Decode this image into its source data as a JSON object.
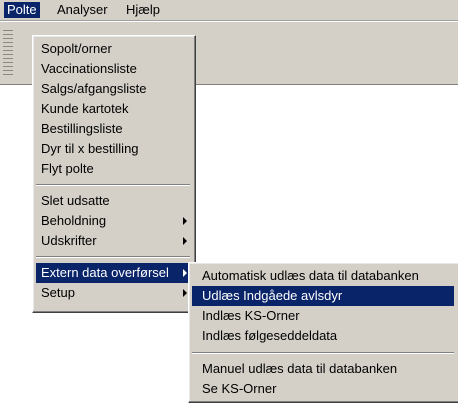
{
  "menubar": {
    "items": [
      {
        "label": "Polte",
        "active": true
      },
      {
        "label": "Analyser",
        "active": false
      },
      {
        "label": "Hjælp",
        "active": false
      }
    ]
  },
  "polte_menu": {
    "items": [
      {
        "label": "Sopolt/orner"
      },
      {
        "label": "Vaccinationsliste"
      },
      {
        "label": "Salgs/afgangsliste"
      },
      {
        "label": "Kunde kartotek"
      },
      {
        "label": "Bestillingsliste"
      },
      {
        "label": "Dyr til x bestilling"
      },
      {
        "label": "Flyt polte"
      },
      {
        "label": "Slet udsatte"
      },
      {
        "label": "Beholdning",
        "submenu": true
      },
      {
        "label": "Udskrifter",
        "submenu": true
      },
      {
        "label": "Extern data overførsel",
        "submenu": true,
        "selected": true
      },
      {
        "label": "Setup",
        "submenu": true
      }
    ]
  },
  "extern_submenu": {
    "items": [
      {
        "label": "Automatisk udlæs data til databanken"
      },
      {
        "label": "Udlæs Indgåede avlsdyr",
        "selected": true
      },
      {
        "label": "Indlæs KS-Orner"
      },
      {
        "label": "Indlæs følgeseddeldata"
      },
      {
        "label": "Manuel udlæs data til databanken"
      },
      {
        "label": "Se KS-Orner"
      }
    ]
  },
  "colors": {
    "menu_bg": "#d4d0c8",
    "highlight": "#0a246a",
    "highlight_text": "#ffffff"
  }
}
